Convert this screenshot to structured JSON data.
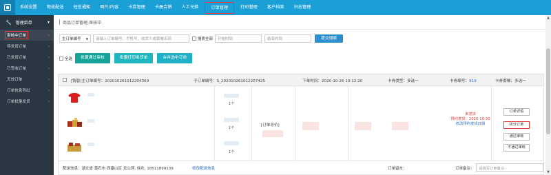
{
  "topbar": {
    "items": [
      {
        "label": "系统设置",
        "active": false
      },
      {
        "label": "物流配送",
        "active": false
      },
      {
        "label": "短信通知",
        "active": false
      },
      {
        "label": "图片/内容",
        "active": false
      },
      {
        "label": "卡券管理",
        "active": false
      },
      {
        "label": "卡册会销",
        "active": false
      },
      {
        "label": "人工兑换",
        "active": false
      },
      {
        "label": "订单管理",
        "active": true
      },
      {
        "label": "打印管理",
        "active": false
      },
      {
        "label": "客户档案",
        "active": false
      },
      {
        "label": "日志管理",
        "active": false
      }
    ]
  },
  "sidebar": {
    "header": "管理菜单",
    "items": [
      {
        "label": "审核中订单",
        "active": true
      },
      {
        "label": "待发货订单"
      },
      {
        "label": "已发货订单"
      },
      {
        "label": "已签收订单"
      },
      {
        "label": "无效订单"
      },
      {
        "label": "订单信息导出"
      },
      {
        "label": "订单批量发货"
      }
    ]
  },
  "breadcrumb": "商品订单管理-审核中",
  "filters": {
    "order_type": "主订单编号",
    "search_placeholder": "请输入订单编号、手机号、收货人或套餐名称",
    "search_all_label": "搜索全部",
    "start_placeholder": "开始时间",
    "end_placeholder": "结束时间",
    "submit_label": "提交搜索"
  },
  "actions": {
    "select_all": "全选",
    "batch_approve": "批量通过审核",
    "batch_print": "批量打印发货单",
    "merge_orders": "合并选中订单"
  },
  "order": {
    "header": {
      "main_no": "[钱智]主订单编号：202010261012204369",
      "sub_no": "子订单编号：S_202010261012207425",
      "order_time": "下单时间：2020-10-26 10:12:20",
      "card_type": "卡券类型：多选一",
      "card_no_label": "卡券编号：",
      "card_no": "919",
      "card_name": "卡券套餐：多选一"
    },
    "qty_labels": [
      "1个",
      "1个",
      "1个"
    ],
    "total_label": "[订单总价]",
    "status": {
      "line1": "未发货",
      "line2": "预约发货：2020-10-30",
      "line3": "修改预约发货日期"
    },
    "buttons": [
      "订单详情",
      "拆分订单",
      "通过审核",
      "不通过审核"
    ],
    "footer": {
      "shipping": "配送信息：湖北省 黄石市 西塞山区 龙山洞, 徐欢, 18511899139",
      "edit_shipping": "修改配送信息",
      "remark_label": "订单留言：",
      "note_label": "订单备注：",
      "note_placeholder": "请填写订单备注"
    }
  },
  "colors": {
    "topbar": "#1a9fd6",
    "sidebar": "#2b3643",
    "highlight": "#e23b3b",
    "btn_teal_1": "#16a39a",
    "btn_teal_2": "#1fb6c0",
    "btn_teal_3": "#1fb0c8"
  }
}
